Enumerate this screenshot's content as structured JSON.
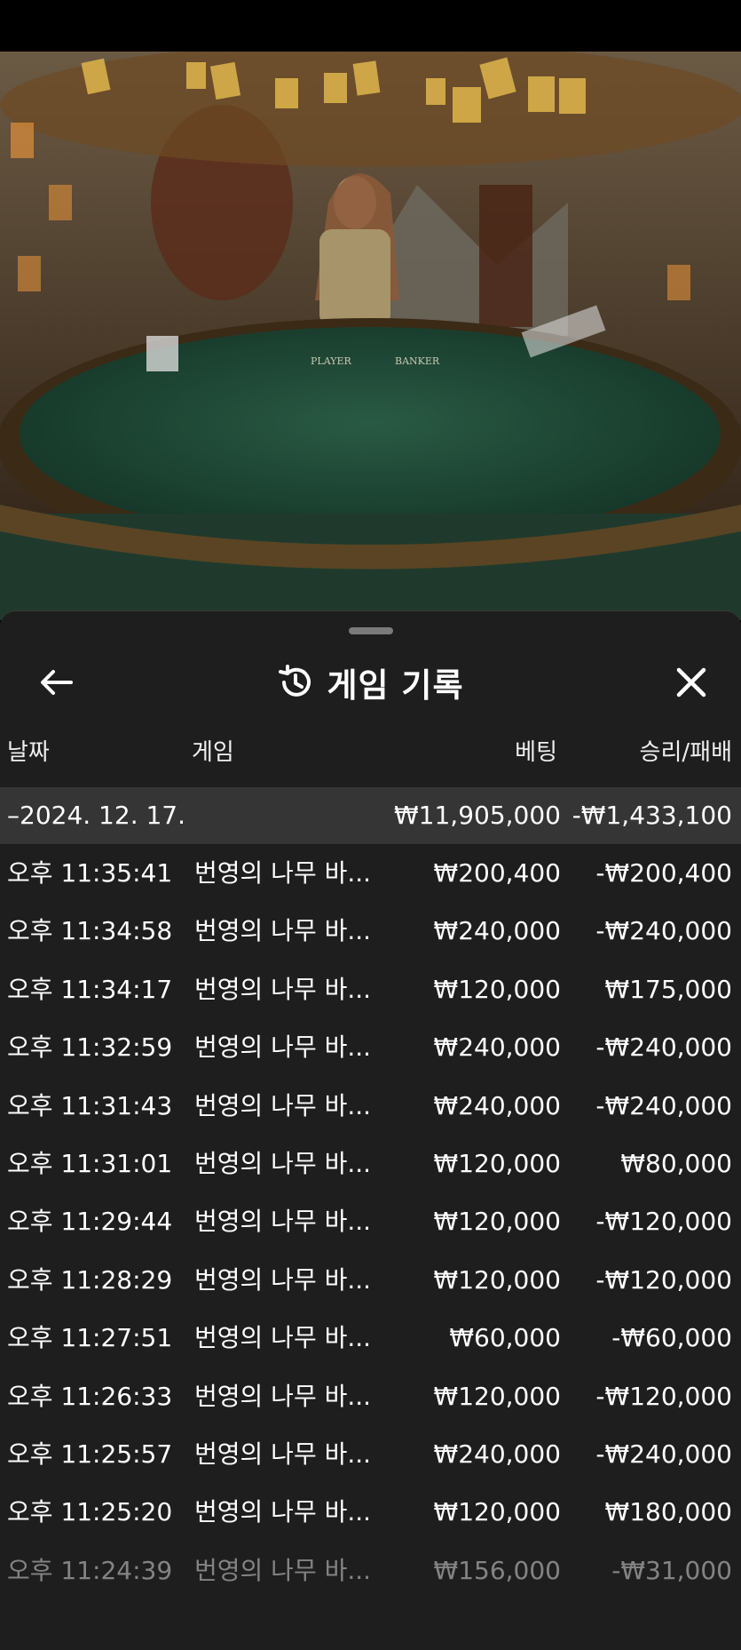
{
  "video": {
    "table_labels": {
      "player": "PLAYER",
      "banker": "BANKER"
    }
  },
  "header": {
    "title": "게임 기록",
    "back_icon": "arrow-left-icon",
    "history_icon": "history-clock-icon",
    "close_icon": "close-icon"
  },
  "columns": {
    "date": "날짜",
    "game": "게임",
    "bet": "베팅",
    "result": "승리/패배"
  },
  "summary": {
    "date": "–2024. 12. 17.",
    "bet": "₩11,905,000",
    "result": "-₩1,433,100"
  },
  "rows": [
    {
      "time": "오후 11:35:41",
      "game": "번영의 나무 바...",
      "bet": "₩200,400",
      "result": "-₩200,400"
    },
    {
      "time": "오후 11:34:58",
      "game": "번영의 나무 바...",
      "bet": "₩240,000",
      "result": "-₩240,000"
    },
    {
      "time": "오후 11:34:17",
      "game": "번영의 나무 바...",
      "bet": "₩120,000",
      "result": "₩175,000"
    },
    {
      "time": "오후 11:32:59",
      "game": "번영의 나무 바...",
      "bet": "₩240,000",
      "result": "-₩240,000"
    },
    {
      "time": "오후 11:31:43",
      "game": "번영의 나무 바...",
      "bet": "₩240,000",
      "result": "-₩240,000"
    },
    {
      "time": "오후 11:31:01",
      "game": "번영의 나무 바...",
      "bet": "₩120,000",
      "result": "₩80,000"
    },
    {
      "time": "오후 11:29:44",
      "game": "번영의 나무 바...",
      "bet": "₩120,000",
      "result": "-₩120,000"
    },
    {
      "time": "오후 11:28:29",
      "game": "번영의 나무 바...",
      "bet": "₩120,000",
      "result": "-₩120,000"
    },
    {
      "time": "오후 11:27:51",
      "game": "번영의 나무 바...",
      "bet": "₩60,000",
      "result": "-₩60,000"
    },
    {
      "time": "오후 11:26:33",
      "game": "번영의 나무 바...",
      "bet": "₩120,000",
      "result": "-₩120,000"
    },
    {
      "time": "오후 11:25:57",
      "game": "번영의 나무 바...",
      "bet": "₩240,000",
      "result": "-₩240,000"
    },
    {
      "time": "오후 11:25:20",
      "game": "번영의 나무 바...",
      "bet": "₩120,000",
      "result": "₩180,000"
    },
    {
      "time": "오후 11:24:39",
      "game": "번영의 나무 바...",
      "bet": "₩156,000",
      "result": "-₩31,000"
    }
  ],
  "colors": {
    "sheet_bg": "#1e1e1e",
    "summary_bg": "#353535",
    "felt": "#1f4a36",
    "text": "#ffffff"
  }
}
